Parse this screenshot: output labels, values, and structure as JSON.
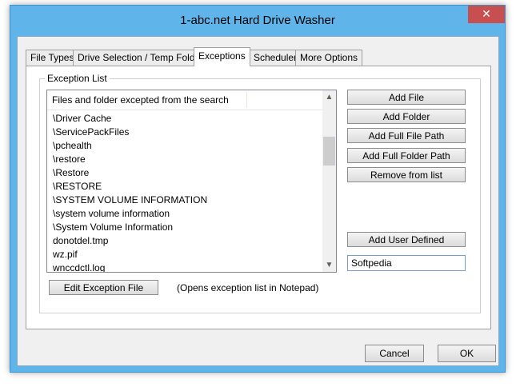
{
  "window": {
    "title": "1-abc.net Hard Drive Washer",
    "close_glyph": "✕"
  },
  "tabs": [
    {
      "label": "File Types"
    },
    {
      "label": "Drive Selection / Temp Folder"
    },
    {
      "label": "Exceptions"
    },
    {
      "label": "Scheduler"
    },
    {
      "label": "More Options"
    }
  ],
  "active_tab": "Exceptions",
  "exceptions": {
    "group_label": "Exception List",
    "list_header": "Files and folder excepted from the search",
    "items": [
      "\\Driver Cache",
      "\\ServicePackFiles",
      "\\pchealth",
      "\\restore",
      "\\Restore",
      "\\RESTORE",
      "\\SYSTEM VOLUME INFORMATION",
      "\\system volume information",
      "\\System Volume Information",
      "donotdel.tmp",
      "wz.pif",
      "wnccdctl.log"
    ],
    "scroll_up_glyph": "▲",
    "scroll_down_glyph": "▼",
    "buttons": {
      "add_file": "Add File",
      "add_folder": "Add Folder",
      "add_full_file_path": "Add Full File Path",
      "add_full_folder_path": "Add Full Folder Path",
      "remove_from_list": "Remove from list",
      "add_user_defined": "Add User Defined",
      "edit_exception_file": "Edit Exception File"
    },
    "user_defined_value": "Softpedia",
    "edit_note": "(Opens exception list in Notepad)"
  },
  "footer": {
    "cancel": "Cancel",
    "ok": "OK"
  }
}
